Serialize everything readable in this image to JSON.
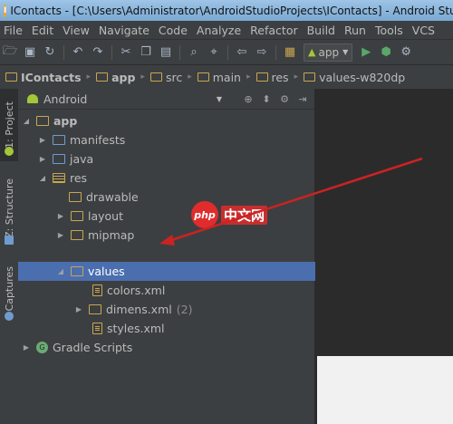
{
  "window": {
    "title": "IContacts - [C:\\Users\\Administrator\\AndroidStudioProjects\\IContacts] - Android Studio"
  },
  "menu": [
    "File",
    "Edit",
    "View",
    "Navigate",
    "Code",
    "Analyze",
    "Refactor",
    "Build",
    "Run",
    "Tools",
    "VCS"
  ],
  "toolbar": {
    "run_config": "app"
  },
  "breadcrumb": [
    "IContacts",
    "app",
    "src",
    "main",
    "res",
    "values-w820dp"
  ],
  "side_tabs": [
    "1: Project",
    "Z: Structure",
    "Captures"
  ],
  "project_panel": {
    "view_mode": "Android"
  },
  "tree": [
    {
      "label": "app",
      "expanded": true,
      "bold": true
    },
    {
      "label": "manifests",
      "expanded": false
    },
    {
      "label": "java",
      "expanded": false
    },
    {
      "label": "res",
      "expanded": true
    },
    {
      "label": "drawable"
    },
    {
      "label": "layout",
      "expanded": false
    },
    {
      "label": "mipmap",
      "expanded": false
    },
    {
      "label": "values",
      "expanded": true,
      "selected": true
    },
    {
      "label": "colors.xml"
    },
    {
      "label": "dimens.xml",
      "count": "(2)",
      "expanded": false
    },
    {
      "label": "styles.xml"
    },
    {
      "label": "Gradle Scripts",
      "expanded": false
    }
  ],
  "watermark": {
    "badge": "php",
    "text": "中文网"
  },
  "colors": {
    "selection": "#4b6eaf",
    "folder": "#c9a651",
    "annotation_arrow": "#cc2222"
  }
}
